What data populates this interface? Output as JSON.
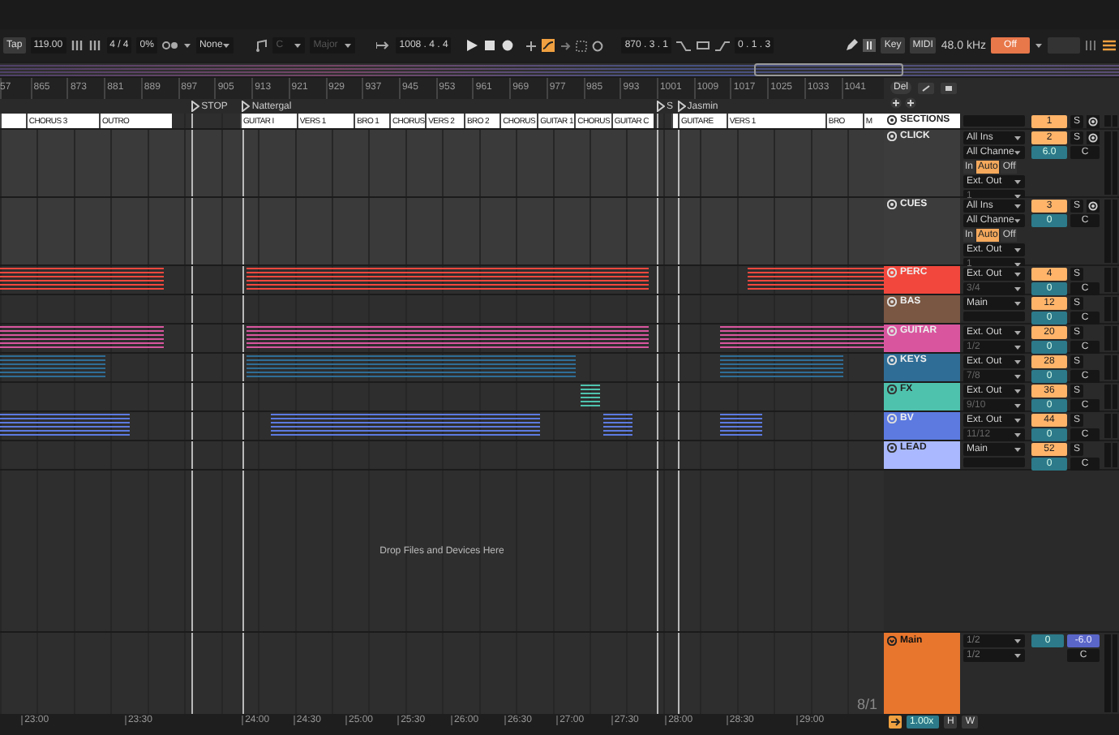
{
  "toolbar": {
    "tap": "Tap",
    "tempo": "119.00",
    "signature": "4 / 4",
    "groove": "0%",
    "quantize": "None",
    "key": {
      "root": "C",
      "scale": "Major",
      "disabled": true
    },
    "position": "1008 . 4 . 4",
    "loop_start": "870 . 3 . 1",
    "loop_length": "0 . 1 . 3",
    "key_map": "Key",
    "midi_map": "MIDI",
    "sample_rate": "48.0 kHz",
    "engine": "Off"
  },
  "arrangement": {
    "ruler": [
      "57",
      "865",
      "873",
      "881",
      "889",
      "897",
      "905",
      "913",
      "921",
      "929",
      "937",
      "945",
      "953",
      "961",
      "969",
      "977",
      "985",
      "993",
      "1001",
      "1009",
      "1017",
      "1025",
      "1033",
      "1041"
    ],
    "locators": [
      {
        "name": "STOP"
      },
      {
        "name": "Nattergal"
      },
      {
        "name": "S"
      },
      {
        "name": "Jasmin"
      }
    ],
    "drop_hint": "Drop Files and Devices Here",
    "grid_label": "8/1",
    "time_ruler": [
      "23:00",
      "23:30",
      "24:00",
      "24:30",
      "25:00",
      "25:30",
      "26:00",
      "26:30",
      "27:00",
      "27:30",
      "28:00",
      "28:30",
      "29:00"
    ]
  },
  "mixer_tools": {
    "delete": "Del"
  },
  "tracks": [
    {
      "kind": "sections",
      "name": "SECTIONS",
      "color": "#ffffff",
      "number": "1",
      "solo": "S",
      "clips": [
        "CHORUS 3",
        "OUTRO",
        "GUITAR I",
        "VERS 1",
        "BRO 1",
        "CHORUS",
        "VERS 2",
        "BRO 2",
        "CHORUS",
        "GUITAR 1",
        "CHORUS",
        "GUITAR C",
        "GUITARE",
        "VERS 1",
        "BRO",
        "M"
      ]
    },
    {
      "kind": "audio",
      "name": "CLICK",
      "color": "#3c3c3c",
      "input": "All Ins",
      "input_channel": "All Channe",
      "monitor": [
        {
          "label": "In",
          "selected": false
        },
        {
          "label": "Auto",
          "selected": true
        },
        {
          "label": "Off",
          "selected": false
        }
      ],
      "output": "Ext. Out",
      "output_channel": "1",
      "number": "2",
      "solo": "S",
      "volume": "6.0",
      "pan": "C"
    },
    {
      "kind": "audio",
      "name": "CUES",
      "color": "#3c3c3c",
      "input": "All Ins",
      "input_channel": "All Channe",
      "monitor": [
        {
          "label": "In",
          "selected": false
        },
        {
          "label": "Auto",
          "selected": true
        },
        {
          "label": "Off",
          "selected": false
        }
      ],
      "output": "Ext. Out",
      "output_channel": "1",
      "number": "3",
      "solo": "S",
      "volume": "0",
      "pan": "C"
    },
    {
      "kind": "midi",
      "name": "PERC",
      "color": "#f2473d",
      "output": "Ext. Out",
      "output_channel": "3/4",
      "number": "4",
      "solo": "S",
      "volume": "0",
      "pan": "C"
    },
    {
      "kind": "midi",
      "name": "BAS",
      "color": "#7a5743",
      "output": "Main",
      "number": "12",
      "solo": "S",
      "volume": "0",
      "pan": "C"
    },
    {
      "kind": "midi",
      "name": "GUITAR",
      "color": "#d9569f",
      "output": "Ext. Out",
      "output_channel": "1/2",
      "number": "20",
      "solo": "S",
      "volume": "0",
      "pan": "C"
    },
    {
      "kind": "midi",
      "name": "KEYS",
      "color": "#2f6d96",
      "output": "Ext. Out",
      "output_channel": "7/8",
      "number": "28",
      "solo": "S",
      "volume": "0",
      "pan": "C"
    },
    {
      "kind": "midi",
      "name": "FX",
      "color": "#4fc2ad",
      "output": "Ext. Out",
      "output_channel": "9/10",
      "number": "36",
      "solo": "S",
      "volume": "0",
      "pan": "C"
    },
    {
      "kind": "midi",
      "name": "BV",
      "color": "#5c7ae0",
      "output": "Ext. Out",
      "output_channel": "11/12",
      "number": "44",
      "solo": "S",
      "volume": "0",
      "pan": "C"
    },
    {
      "kind": "midi",
      "name": "LEAD",
      "color": "#a9b8ff",
      "output": "Main",
      "number": "52",
      "solo": "S",
      "volume": "0",
      "pan": "C"
    }
  ],
  "main": {
    "name": "Main",
    "color": "#e8762d",
    "output": "1/2",
    "output_channel": "1/2",
    "volume": "0",
    "cue_volume": "-6.0",
    "pan": "C"
  },
  "footer": {
    "zoom": "1.00x",
    "buttons": [
      "H",
      "W"
    ]
  }
}
